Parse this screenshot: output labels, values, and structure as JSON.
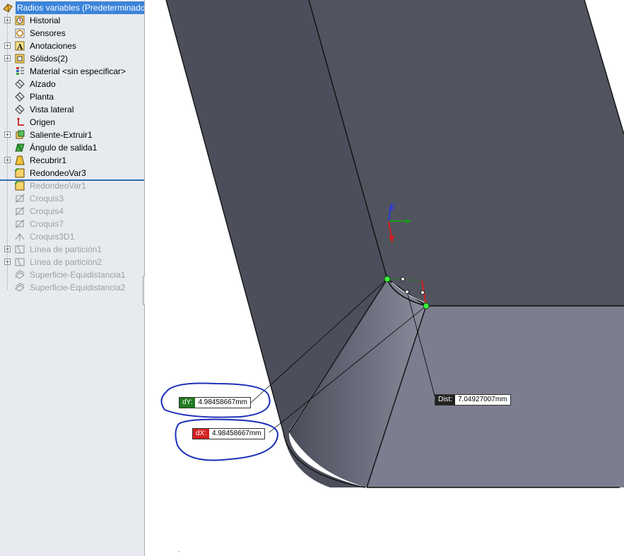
{
  "tree": {
    "root": {
      "label": "Radios variables  (Predeterminado",
      "icon": "part-icon"
    },
    "items": [
      {
        "label": "Historial",
        "icon": "history-icon",
        "expandable": true
      },
      {
        "label": "Sensores",
        "icon": "sensor-icon",
        "expandable": false
      },
      {
        "label": "Anotaciones",
        "icon": "annotation-icon",
        "expandable": true
      },
      {
        "label": "Sólidos(2)",
        "icon": "solid-bodies-icon",
        "expandable": true
      },
      {
        "label": "Material <sin especificar>",
        "icon": "material-icon",
        "expandable": false
      },
      {
        "label": "Alzado",
        "icon": "plane-icon",
        "expandable": false
      },
      {
        "label": "Planta",
        "icon": "plane-icon",
        "expandable": false
      },
      {
        "label": "Vista lateral",
        "icon": "plane-icon",
        "expandable": false
      },
      {
        "label": "Origen",
        "icon": "origin-icon",
        "expandable": false
      },
      {
        "label": "Saliente-Extruir1",
        "icon": "extrude-icon",
        "expandable": true
      },
      {
        "label": "Ángulo de salida1",
        "icon": "draft-icon",
        "expandable": false
      },
      {
        "label": "Recubrir1",
        "icon": "loft-icon",
        "expandable": true
      },
      {
        "label": "RedondeoVar3",
        "icon": "fillet-icon",
        "expandable": false
      }
    ],
    "suppressed": [
      {
        "label": "RedondeoVar1",
        "icon": "fillet-icon",
        "expandable": false
      },
      {
        "label": "Croquis3",
        "icon": "sketch-icon",
        "expandable": false
      },
      {
        "label": "Croquis4",
        "icon": "sketch-icon",
        "expandable": false
      },
      {
        "label": "Croquis7",
        "icon": "sketch-icon",
        "expandable": false
      },
      {
        "label": "Croquis3D1",
        "icon": "sketch3d-icon",
        "expandable": false
      },
      {
        "label": "Línea de partición1",
        "icon": "split-line-icon",
        "expandable": true
      },
      {
        "label": "Línea de partición2",
        "icon": "split-line-icon",
        "expandable": true
      },
      {
        "label": "Superficie-Equidistancia1",
        "icon": "offset-surface-icon",
        "expandable": false
      },
      {
        "label": "Superficie-Equidistancia2",
        "icon": "offset-surface-icon",
        "expandable": false
      }
    ]
  },
  "measure": {
    "dy": {
      "key": "dY:",
      "value": "4.98458667mm",
      "color": "#1f7a1f"
    },
    "dx": {
      "key": "dX:",
      "value": "4.98458667mm",
      "color": "#d42020"
    },
    "dist": {
      "key": "Dist:",
      "value": "7.04927007mm",
      "color": "#222222"
    }
  },
  "colors": {
    "face_dark": "#50535f",
    "face_light": "#7c7f90",
    "annotation_ink": "#1c2fb8"
  }
}
